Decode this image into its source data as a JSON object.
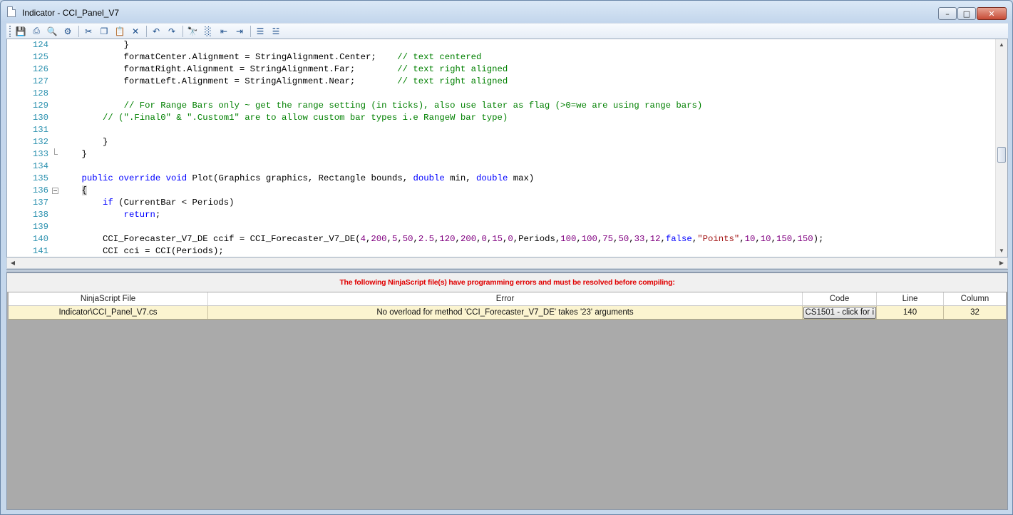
{
  "window": {
    "title": "Indicator - CCI_Panel_V7",
    "min_glyph": "–",
    "max_glyph": "□",
    "close_glyph": "✕"
  },
  "toolbar": {
    "items": [
      {
        "name": "save-icon",
        "glyph": "💾"
      },
      {
        "name": "print-icon",
        "glyph": "⎙"
      },
      {
        "name": "print-preview-icon",
        "glyph": "🔍"
      },
      {
        "name": "page-setup-icon",
        "glyph": "⚙"
      },
      {
        "name": "cut-icon",
        "glyph": "✂"
      },
      {
        "name": "copy-icon",
        "glyph": "❐"
      },
      {
        "name": "paste-icon",
        "glyph": "📋"
      },
      {
        "name": "delete-icon",
        "glyph": "✕"
      },
      {
        "name": "undo-icon",
        "glyph": "↶"
      },
      {
        "name": "redo-icon",
        "glyph": "↷"
      },
      {
        "name": "find-icon",
        "glyph": "🔭"
      },
      {
        "name": "replace-icon",
        "glyph": "░"
      },
      {
        "name": "outdent-icon",
        "glyph": "⇤"
      },
      {
        "name": "indent-icon",
        "glyph": "⇥"
      },
      {
        "name": "comment-icon",
        "glyph": "☰"
      },
      {
        "name": "uncomment-icon",
        "glyph": "☱"
      }
    ]
  },
  "editor": {
    "lines": [
      {
        "n": "124",
        "text": "            }"
      },
      {
        "n": "125",
        "text": "            formatCenter.Alignment = StringAlignment.Center;    // text centered"
      },
      {
        "n": "126",
        "text": "            formatRight.Alignment = StringAlignment.Far;        // text right aligned"
      },
      {
        "n": "127",
        "text": "            formatLeft.Alignment = StringAlignment.Near;        // text right aligned"
      },
      {
        "n": "128",
        "text": ""
      },
      {
        "n": "129",
        "text": "            // For Range Bars only ~ get the range setting (in ticks), also use later as flag (>0=we are using range bars)"
      },
      {
        "n": "130",
        "text": "        // (\".Final0\" & \".Custom1\" are to allow custom bar types i.e RangeW bar type)"
      },
      {
        "n": "131",
        "text": ""
      },
      {
        "n": "132",
        "text": "        }"
      },
      {
        "n": "133",
        "text": "    }"
      },
      {
        "n": "134",
        "text": ""
      },
      {
        "n": "135",
        "text": "    public override void Plot(Graphics graphics, Rectangle bounds, double min, double max)"
      },
      {
        "n": "136",
        "text": "    {"
      },
      {
        "n": "137",
        "text": "        if (CurrentBar < Periods)"
      },
      {
        "n": "138",
        "text": "            return;"
      },
      {
        "n": "139",
        "text": ""
      },
      {
        "n": "140",
        "text": "        CCI_Forecaster_V7_DE ccif = CCI_Forecaster_V7_DE(4,200,5,50,2.5,120,200,0,15,0,Periods,100,100,75,50,33,12,false,\"Points\",10,10,150,150);"
      },
      {
        "n": "141",
        "text": "        CCI cci = CCI(Periods);"
      }
    ]
  },
  "errors": {
    "banner": "The following NinjaScript file(s) have programming errors and must be resolved before compiling:",
    "columns": [
      "NinjaScript File",
      "Error",
      "Code",
      "Line",
      "Column"
    ],
    "rows": [
      {
        "file": "Indicator\\CCI_Panel_V7.cs",
        "error": "No overload for method 'CCI_Forecaster_V7_DE' takes '23' arguments",
        "code": "CS1501 - click for i",
        "line": "140",
        "column": "32"
      }
    ]
  },
  "colors": {
    "keyword": "#0000ff",
    "comment": "#008000",
    "number": "#800080",
    "string": "#a31515",
    "line_number": "#2b91af",
    "error_text": "#e00000",
    "error_row_bg": "#fbf4d0"
  }
}
